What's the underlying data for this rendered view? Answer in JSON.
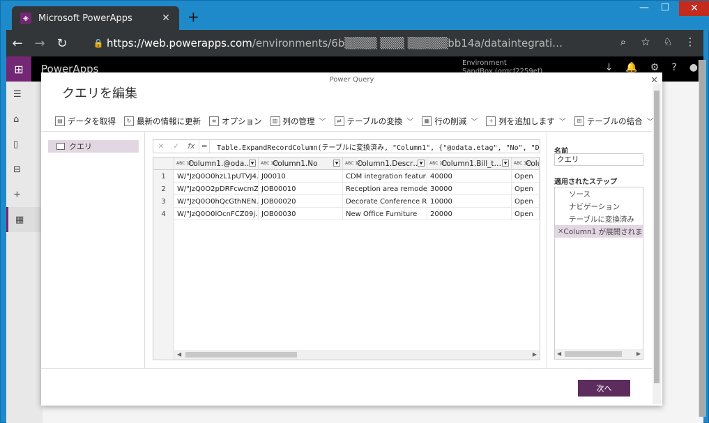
{
  "browser": {
    "tab_title": "Microsoft PowerApps",
    "tab_close": "✕",
    "new_tab": "+",
    "url_host": "https://web.powerapps.com",
    "url_rest": "/environments/6b▒▒▒▒  ▒▒▒  ▒▒▒▒▒bb14a/dataintegrati…",
    "win_min": "—",
    "win_max": "☐",
    "win_close": "✕"
  },
  "app": {
    "brand": "PowerApps",
    "env_label": "Environment",
    "env_name": "SandBox (orgcf2259ef)"
  },
  "modal": {
    "pq_title": "Power Query",
    "heading": "クエリを編集",
    "close": "✕",
    "ribbon": [
      {
        "label": "データを取得",
        "dropdown": false
      },
      {
        "label": "最新の情報に更新",
        "dropdown": false
      },
      {
        "label": "オプション",
        "dropdown": false
      },
      {
        "label": "列の管理",
        "dropdown": true
      },
      {
        "label": "テーブルの変換",
        "dropdown": true
      },
      {
        "label": "行の削減",
        "dropdown": true
      },
      {
        "label": "列を追加します",
        "dropdown": true
      },
      {
        "label": "テーブルの結合",
        "dropdown": true
      }
    ],
    "queries": [
      {
        "label": "クエリ"
      }
    ],
    "formula": {
      "eq": "=",
      "text": "Table.ExpandRecordColumn(テーブルに変換済み, \"Column1\", {\"@odata.etag\", \"No\", \"De"
    },
    "table": {
      "headers": [
        "Column1.@oda…",
        "Column1.No",
        "Column1.Descr…",
        "Column1.Bill_t…",
        "Colum"
      ],
      "rows": [
        {
          "n": "1",
          "c": [
            "W/\"JzQ0O0hzL1pUTVJ4…",
            "J00010",
            "CDM integration featur…",
            "40000",
            "Open"
          ]
        },
        {
          "n": "2",
          "c": [
            "W/\"JzQ0O2pDRFcwcmZ…",
            "JOB00010",
            "Reception area remodel",
            "30000",
            "Open"
          ]
        },
        {
          "n": "3",
          "c": [
            "W/\"JzQ0O0hQcGthNEN…",
            "JOB00020",
            "Decorate Conference R…",
            "10000",
            "Open"
          ]
        },
        {
          "n": "4",
          "c": [
            "W/\"JzQ0O0lOcnFCZ09j…",
            "JOB00030",
            "New Office Furniture",
            "20000",
            "Open"
          ]
        }
      ]
    },
    "name_label": "名前",
    "name_value": "クエリ",
    "steps_label": "適用されたステップ",
    "steps": [
      "ソース",
      "ナビゲーション",
      "テーブルに変換済み",
      "Column1 が展開されまし"
    ],
    "next_label": "次へ"
  }
}
